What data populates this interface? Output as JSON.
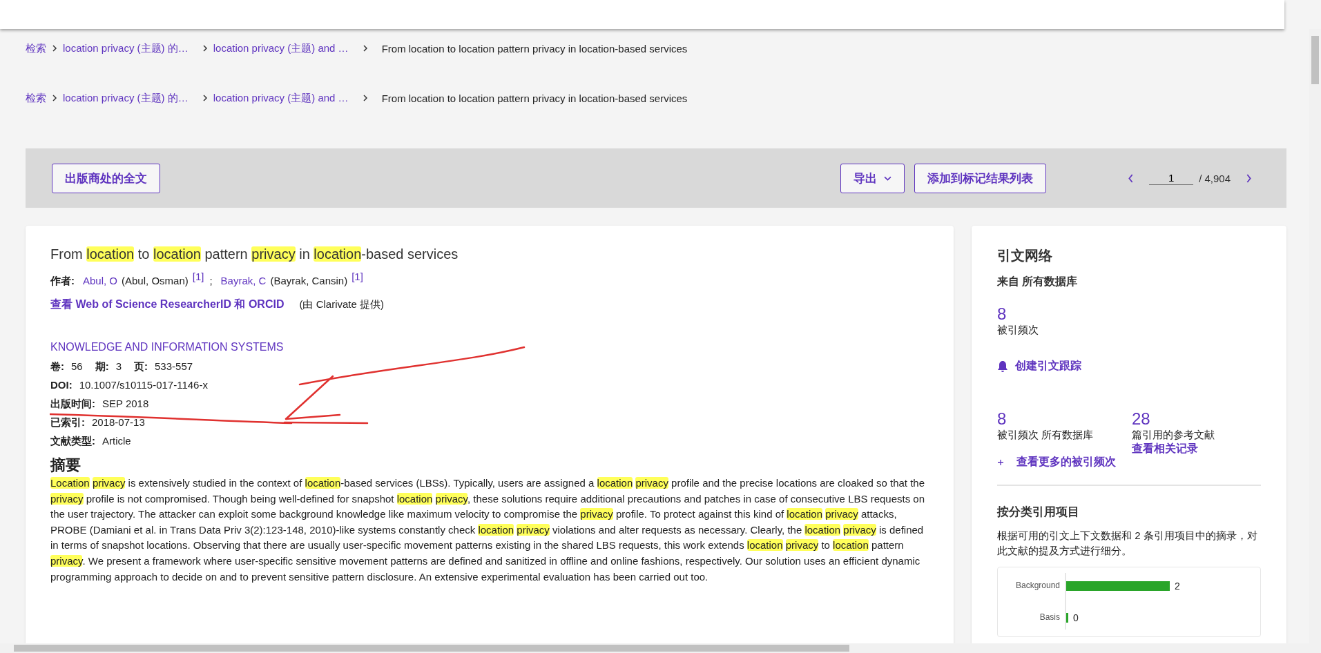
{
  "breadcrumbs": [
    [
      {
        "text": "检索",
        "kind": "link"
      },
      {
        "text": "location privacy (主题) 的…",
        "kind": "link"
      },
      {
        "text": "location privacy (主题) and …",
        "kind": "link"
      },
      {
        "text": "From location to location pattern privacy in location-based services",
        "kind": "current"
      }
    ],
    [
      {
        "text": "检索",
        "kind": "link"
      },
      {
        "text": "location privacy (主题) 的…",
        "kind": "link"
      },
      {
        "text": "location privacy (主题) and …",
        "kind": "link"
      },
      {
        "text": "From location to location pattern privacy in location-based services",
        "kind": "current"
      }
    ]
  ],
  "toolbar": {
    "full_text_button": "出版商处的全文",
    "export_button": "导出",
    "add_button": "添加到标记结果列表",
    "pager": {
      "page": "1",
      "total": "/ 4,904"
    }
  },
  "record": {
    "title": [
      {
        "text": "From ",
        "highlight": false
      },
      {
        "text": "location",
        "highlight": true
      },
      {
        "text": " to ",
        "highlight": false
      },
      {
        "text": "location",
        "highlight": true
      },
      {
        "text": " pattern ",
        "highlight": false
      },
      {
        "text": "privacy",
        "highlight": true
      },
      {
        "text": " in ",
        "highlight": false
      },
      {
        "text": "location",
        "highlight": true
      },
      {
        "text": "-based services",
        "highlight": false
      }
    ],
    "authors_label": "作者:",
    "author_separator": ";",
    "authors": [
      {
        "short": "Abul, O",
        "full": "(Abul, Osman)",
        "sup": "[1]"
      },
      {
        "short": "Bayrak, C",
        "full": "(Bayrak, Cansin)",
        "sup": "[1]"
      }
    ],
    "orcid_link": "查看 Web of Science ResearcherID 和 ORCID",
    "orcid_note": "(由 Clarivate 提供)",
    "journal": "KNOWLEDGE AND INFORMATION SYSTEMS",
    "fields": [
      [
        {
          "label": "卷:",
          "value": "56"
        },
        {
          "label": "期:",
          "value": "3"
        },
        {
          "label": "页:",
          "value": "533-557"
        }
      ],
      [
        {
          "label": "DOI:",
          "value": "10.1007/s10115-017-1146-x"
        }
      ],
      [
        {
          "label": "出版时间:",
          "value": "SEP 2018"
        }
      ],
      [
        {
          "label": "已索引:",
          "value": "2018-07-13"
        }
      ],
      [
        {
          "label": "文献类型:",
          "value": "Article"
        }
      ]
    ],
    "abstract_heading": "摘要",
    "abstract": [
      {
        "text": "Location privacy",
        "highlight": true
      },
      {
        "text": " is extensively studied in the context of ",
        "highlight": false
      },
      {
        "text": "location",
        "highlight": true
      },
      {
        "text": "-based services (LBSs). Typically, users are assigned a ",
        "highlight": false
      },
      {
        "text": "location privacy",
        "highlight": true
      },
      {
        "text": " profile and the precise locations are cloaked so that the ",
        "highlight": false
      },
      {
        "text": "privacy",
        "highlight": true
      },
      {
        "text": " profile is not compromised. Though being well-defined for snapshot ",
        "highlight": false
      },
      {
        "text": "location privacy",
        "highlight": true
      },
      {
        "text": ", these solutions require additional precautions and patches in case of consecutive LBS requests on the user trajectory. The attacker can exploit some background knowledge like maximum velocity to compromise the ",
        "highlight": false
      },
      {
        "text": "privacy",
        "highlight": true
      },
      {
        "text": " profile. To protect against this kind of ",
        "highlight": false
      },
      {
        "text": "location privacy",
        "highlight": true
      },
      {
        "text": " attacks, PROBE (Damiani et al. in Trans Data Priv 3(2):123-148, 2010)-like systems constantly check ",
        "highlight": false
      },
      {
        "text": "location privacy",
        "highlight": true
      },
      {
        "text": " violations and alter requests as necessary. Clearly, the ",
        "highlight": false
      },
      {
        "text": "location privacy",
        "highlight": true
      },
      {
        "text": " is defined in terms of snapshot locations. Observing that there are usually user-specific movement patterns existing in the shared LBS requests, this work extends ",
        "highlight": false
      },
      {
        "text": "location privacy",
        "highlight": true
      },
      {
        "text": " to ",
        "highlight": false
      },
      {
        "text": "location",
        "highlight": true
      },
      {
        "text": " pattern ",
        "highlight": false
      },
      {
        "text": "privacy",
        "highlight": true
      },
      {
        "text": ". We present a framework where user-specific sensitive movement patterns are defined and sanitized in offline and online fashions, respectively. Our solution uses an efficient dynamic programming approach to decide on and to prevent sensitive pattern disclosure. An extensive experimental evaluation has been carried out too.",
        "highlight": false
      }
    ]
  },
  "citation_network": {
    "title": "引文网络",
    "source": "来自 所有数据库",
    "count": "8",
    "count_label": "被引频次",
    "alert_link": "创建引文跟踪",
    "stats": [
      {
        "value": "8",
        "label": "被引频次 所有数据库"
      },
      {
        "value": "28",
        "label": "篇引用的参考文献",
        "link": "查看相关记录"
      }
    ],
    "more_link": "查看更多的被引频次"
  },
  "classification": {
    "title": "按分类引用项目",
    "description": "根据可用的引文上下文数据和 2 条引用项目中的摘录，对此文献的提及方式进行细分。",
    "chart_data": {
      "type": "bar",
      "orientation": "horizontal",
      "categories": [
        "Background",
        "Basis"
      ],
      "values": [
        2,
        0
      ],
      "xlim": [
        0,
        2
      ],
      "data_labels": true
    }
  }
}
